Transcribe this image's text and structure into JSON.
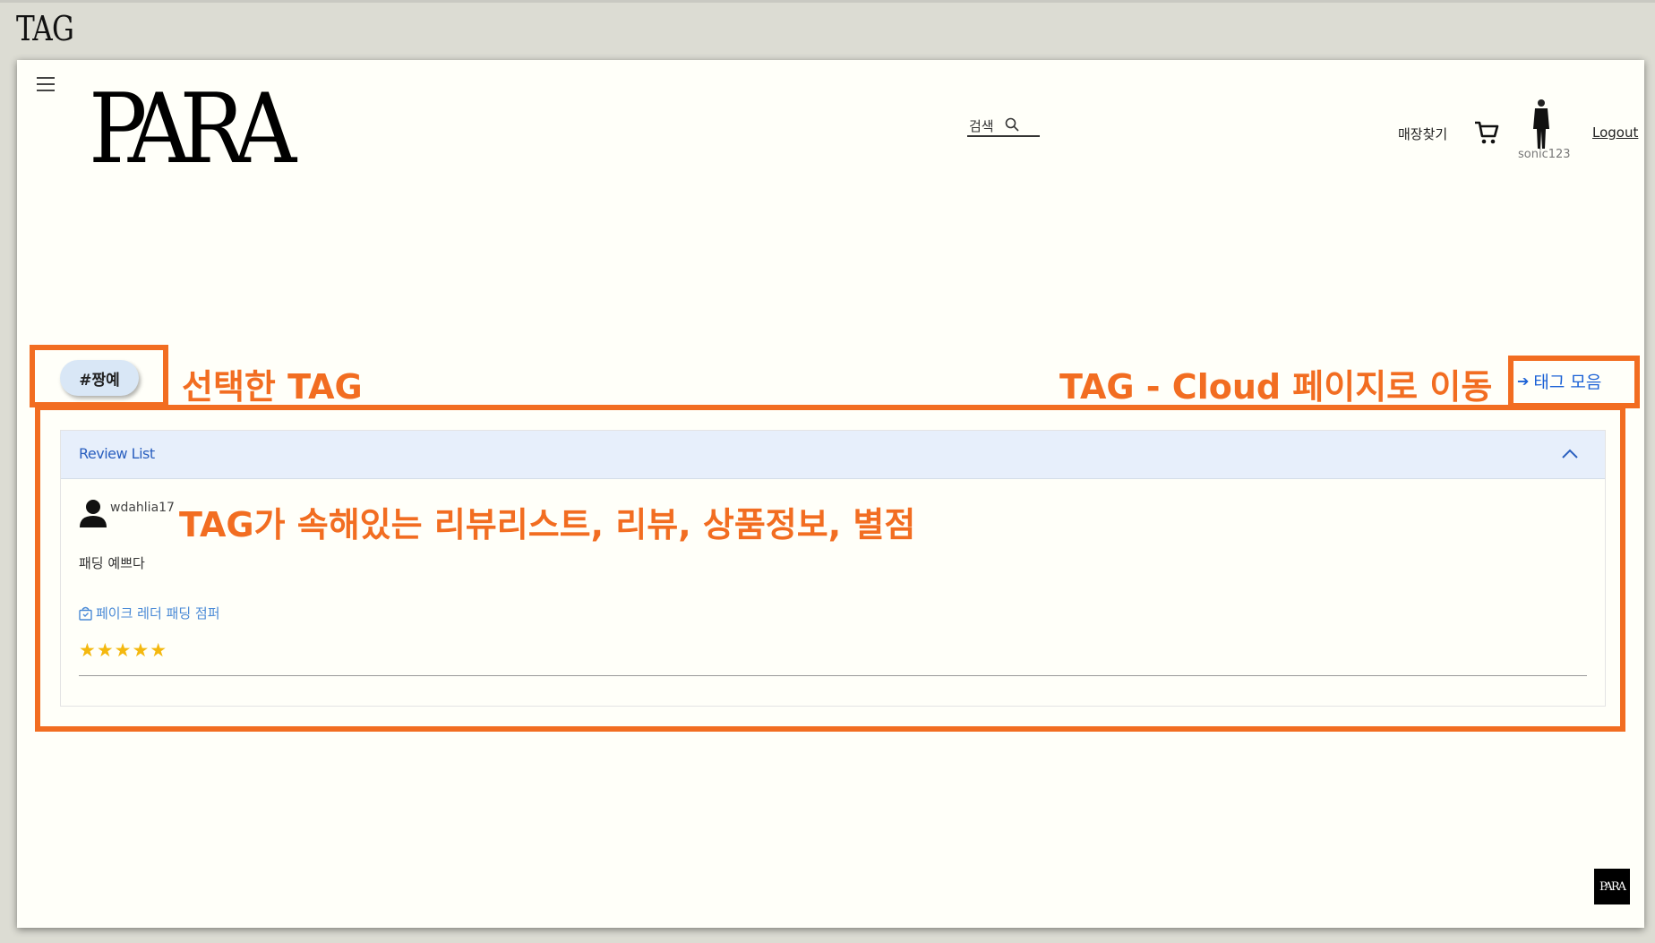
{
  "slide": {
    "title": "TAG"
  },
  "header": {
    "logo": "PARA",
    "search_label": "검색",
    "store_link": "매장찾기",
    "username": "sonic123",
    "logout": "Logout"
  },
  "tag": {
    "selected": "#짱예",
    "collection_link": "태그 모음"
  },
  "review_list": {
    "title": "Review List",
    "reviews": [
      {
        "user": "wdahlia17",
        "text": "패딩 예쁘다",
        "product": "페이크 레더 패딩 점퍼",
        "stars": "★★★★★",
        "rating": 5
      }
    ]
  },
  "corner_logo": "PARA",
  "annotations": {
    "selected_tag": "선택한 TAG",
    "tag_cloud": "TAG - Cloud 페이지로 이동",
    "review_info": "TAG가 속해있는 리뷰리스트, 리뷰, 상품정보, 별점"
  },
  "colors": {
    "annotation": "#f26d21",
    "link": "#1c62d6",
    "star": "#f4b80f",
    "header_band": "#e7effb"
  }
}
